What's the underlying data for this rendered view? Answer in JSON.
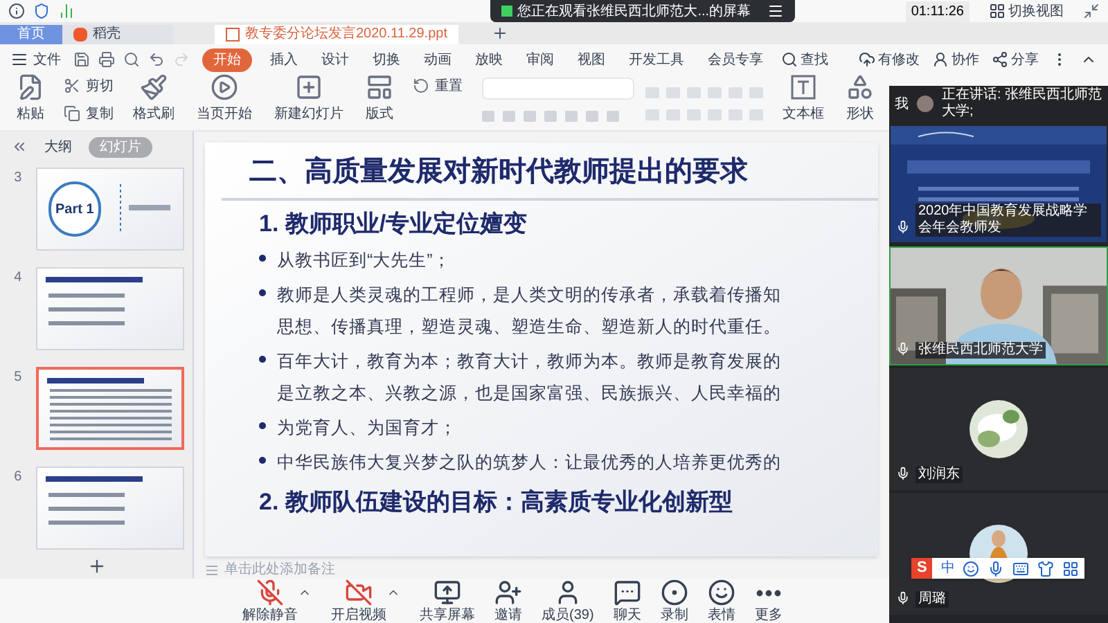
{
  "meeting_bar": {
    "notice": "您正在观看张维民西北师范大...的屏幕",
    "timer": "01:11:26",
    "switch_view": "切换视图"
  },
  "doc_tabs": [
    {
      "label": "首页",
      "kind": "home",
      "selected": false
    },
    {
      "label": "稻壳",
      "kind": "store",
      "selected": false
    },
    {
      "label": "教专委分论坛发言2020.11.29.ppt",
      "kind": "doc",
      "selected": true
    }
  ],
  "menu": {
    "file": "文件",
    "search": "查找",
    "tabs": [
      {
        "label": "开始",
        "selected": true
      },
      {
        "label": "插入",
        "selected": false
      },
      {
        "label": "设计",
        "selected": false
      },
      {
        "label": "切换",
        "selected": false
      },
      {
        "label": "动画",
        "selected": false
      },
      {
        "label": "放映",
        "selected": false
      },
      {
        "label": "审阅",
        "selected": false
      },
      {
        "label": "视图",
        "selected": false
      },
      {
        "label": "开发工具",
        "selected": false
      },
      {
        "label": "会员专享",
        "selected": false
      }
    ],
    "actions": [
      {
        "label": "有修改",
        "kind": "cloud"
      },
      {
        "label": "协作",
        "kind": "user"
      },
      {
        "label": "分享",
        "kind": "share"
      }
    ]
  },
  "ribbon": [
    {
      "label": "粘贴",
      "kind": "paste"
    },
    {
      "label": "剪切",
      "kind": "cut"
    },
    {
      "label": "复制",
      "kind": "copy"
    },
    {
      "label": "格式刷",
      "kind": "brush"
    },
    {
      "label": "当页开始",
      "kind": "play"
    },
    {
      "label": "新建幻灯片",
      "kind": "new"
    },
    {
      "label": "版式",
      "kind": "layout"
    },
    {
      "label": "重置",
      "kind": "reset"
    },
    {
      "label": "文本框",
      "kind": "textbox"
    },
    {
      "label": "形状",
      "kind": "shape"
    }
  ],
  "outline_tabs": [
    {
      "label": "大纲",
      "selected": false
    },
    {
      "label": "幻灯片",
      "selected": true
    }
  ],
  "slides": [
    {
      "number": "3",
      "kind": "part",
      "title": "Part 1",
      "selected": false
    },
    {
      "number": "4",
      "kind": "bullets",
      "selected": false
    },
    {
      "number": "5",
      "kind": "dense",
      "selected": true
    },
    {
      "number": "6",
      "kind": "bullets",
      "selected": false
    }
  ],
  "slide": {
    "title": "二、高质量发展对新时代教师提出的要求",
    "sections": [
      {
        "heading": "1. 教师职业/专业定位嬗变",
        "bullets": [
          [
            "从教书匠到“大先生”；"
          ],
          [
            "教师是人类灵魂的工程师，是人类文明的传承者，承载着传播知",
            "思想、传播真理，塑造灵魂、塑造生命、塑造新人的时代重任。"
          ],
          [
            "百年大计，教育为本；教育大计，教师为本。教师是教育发展的",
            "是立教之本、兴教之源，也是国家富强、民族振兴、人民幸福的"
          ],
          [
            "为党育人、为国育才；"
          ],
          [
            "中华民族伟大复兴梦之队的筑梦人：让最优秀的人培养更优秀的"
          ]
        ]
      },
      {
        "heading": "2. 教师队伍建设的目标：高素质专业化创新型"
      }
    ]
  },
  "notes": {
    "placeholder": "单击此处添加备注"
  },
  "toolbar": [
    {
      "label": "解除静音",
      "kind": "mic",
      "on": false
    },
    {
      "label": "开启视频",
      "kind": "video",
      "on": false
    },
    {
      "label": "共享屏幕",
      "kind": "share"
    },
    {
      "label": "邀请",
      "kind": "invite"
    },
    {
      "label": "成员(39)",
      "kind": "members"
    },
    {
      "label": "聊天",
      "kind": "chat"
    },
    {
      "label": "录制",
      "kind": "record"
    },
    {
      "label": "表情",
      "kind": "emoji"
    },
    {
      "label": "更多",
      "kind": "more"
    }
  ],
  "participants": {
    "me": "我",
    "speaking": "正在讲话: 张维民西北师范大学;",
    "tiles": [
      {
        "name": "2020年中国教育发展战略学会年会教师发",
        "kind": "screen",
        "selected": false
      },
      {
        "name": "张维民西北师范大学",
        "kind": "video",
        "selected": true
      },
      {
        "name": "刘润东",
        "kind": "avatar",
        "selected": false
      },
      {
        "name": "周璐",
        "kind": "avatar",
        "selected": false
      }
    ]
  },
  "ime": {
    "logo": "S",
    "mode": "中"
  }
}
